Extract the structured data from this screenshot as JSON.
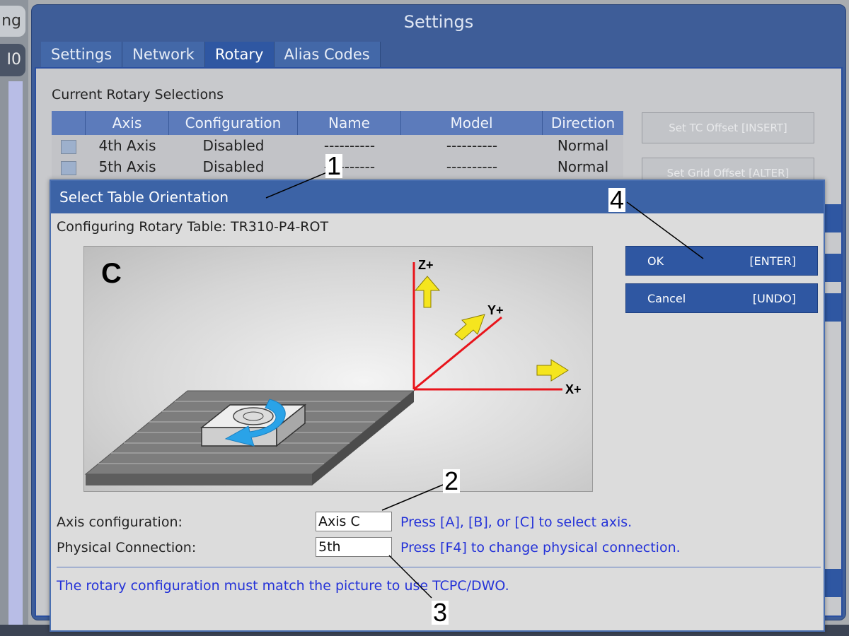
{
  "background": {
    "left_tab_1": "ng",
    "left_tab_2": "I0"
  },
  "settings_window": {
    "title": "Settings",
    "tabs": [
      {
        "label": "Settings",
        "active": false
      },
      {
        "label": "Network",
        "active": false
      },
      {
        "label": "Rotary",
        "active": true
      },
      {
        "label": "Alias Codes",
        "active": false
      }
    ],
    "section_label": "Current Rotary Selections",
    "table": {
      "headers": [
        "",
        "Axis",
        "Configuration",
        "Name",
        "Model",
        "Direction"
      ],
      "rows": [
        {
          "axis": "4th Axis",
          "configuration": "Disabled",
          "name": "----------",
          "model": "----------",
          "direction": "Normal"
        },
        {
          "axis": "5th Axis",
          "configuration": "Disabled",
          "name": "----------",
          "model": "----------",
          "direction": "Normal"
        }
      ]
    },
    "buttons": {
      "set_tc_offset": "Set TC Offset [INSERT]",
      "set_grid_offset": "Set Grid Offset [ALTER]"
    }
  },
  "dialog": {
    "title": "Select Table Orientation",
    "subtitle": "Configuring Rotary Table: TR310-P4-ROT",
    "picture": {
      "axis_letter": "C",
      "z_label": "Z+",
      "y_label": "Y+",
      "x_label": "X+"
    },
    "ok_button": {
      "label": "OK",
      "key": "[ENTER]"
    },
    "cancel_button": {
      "label": "Cancel",
      "key": "[UNDO]"
    },
    "axis_configuration": {
      "label": "Axis configuration:",
      "value": "Axis C",
      "hint": "Press [A], [B], or [C] to select axis."
    },
    "physical_connection": {
      "label": "Physical Connection:",
      "value": "5th",
      "hint": "Press [F4] to change physical connection."
    },
    "note": "The rotary configuration must match the picture to use TCPC/DWO."
  },
  "callouts": [
    "1",
    "2",
    "3",
    "4"
  ],
  "colors": {
    "title_bar": "#3c63a6",
    "button_blue": "#2f57a2",
    "hint_text": "#2432d8",
    "axis_red": "#e8141b",
    "arrow_yellow": "#f5e51e",
    "rotation_arrow": "#2aa3e8"
  }
}
